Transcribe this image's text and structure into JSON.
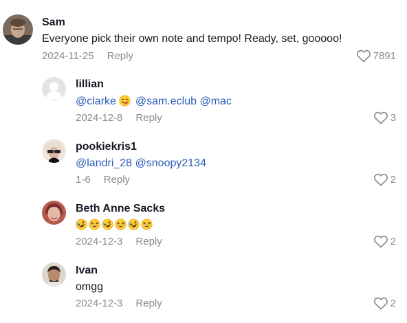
{
  "comments": [
    {
      "author": "Sam",
      "text": "Everyone pick their own note and tempo! Ready, set, gooooo!",
      "date": "2024-11-25",
      "reply": "Reply",
      "likes": "7891"
    },
    {
      "author": "lillian",
      "mentions": [
        "@clarke",
        "@sam.eclub",
        "@mac"
      ],
      "emoji": "face-savoring-food",
      "date": "2024-12-8",
      "reply": "Reply",
      "likes": "3"
    },
    {
      "author": "pookiekris1",
      "mentions": [
        "@landri_28",
        "@snoopy2134"
      ],
      "date": "1-6",
      "reply": "Reply",
      "likes": "2"
    },
    {
      "author": "Beth Anne Sacks",
      "emojis": [
        "rolling-laughing",
        "grinning-squinting",
        "rolling-laughing",
        "grinning-squinting",
        "rolling-laughing",
        "grinning-squinting"
      ],
      "date": "2024-12-3",
      "reply": "Reply",
      "likes": "2"
    },
    {
      "author": "Ivan",
      "text": "omgg",
      "date": "2024-12-3",
      "reply": "Reply",
      "likes": "2"
    }
  ],
  "colors": {
    "mention": "#2b5db9",
    "meta": "#8a8b91",
    "text": "#161823"
  }
}
